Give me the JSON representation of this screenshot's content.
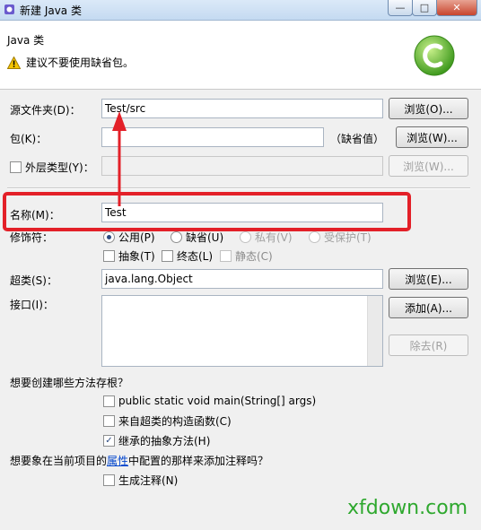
{
  "window": {
    "title": "新建 Java 类",
    "buttons": {
      "minimize": "—",
      "maximize": "□",
      "close": "✕"
    }
  },
  "header": {
    "heading": "Java 类",
    "warning": "建议不要使用缺省包。"
  },
  "form": {
    "source_folder": {
      "label": "源文件夹(D)：",
      "value": "Test/src",
      "button": "浏览(O)..."
    },
    "package": {
      "label": "包(K)：",
      "value": "",
      "hint": "（缺省值）",
      "button": "浏览(W)..."
    },
    "enclosing": {
      "label": "外层类型(Y)：",
      "checked": false,
      "value": "",
      "button": "浏览(W)..."
    },
    "name": {
      "label": "名称(M)：",
      "value": "Test"
    },
    "modifiers": {
      "label": "修饰符：",
      "access": [
        {
          "label": "公用(P)",
          "selected": true,
          "enabled": true
        },
        {
          "label": "缺省(U)",
          "selected": false,
          "enabled": true
        },
        {
          "label": "私有(V)",
          "selected": false,
          "enabled": false
        },
        {
          "label": "受保护(T)",
          "selected": false,
          "enabled": false
        }
      ],
      "flags": [
        {
          "label": "抽象(T)",
          "checked": false
        },
        {
          "label": "终态(L)",
          "checked": false
        },
        {
          "label": "静态(C)",
          "checked": false,
          "enabled": false
        }
      ]
    },
    "superclass": {
      "label": "超类(S)：",
      "value": "java.lang.Object",
      "button": "浏览(E)..."
    },
    "interfaces": {
      "label": "接口(I)：",
      "add_button": "添加(A)...",
      "remove_button": "除去(R)"
    },
    "stubs": {
      "question": "想要创建哪些方法存根？",
      "options": [
        {
          "label": "public static void main(String[] args)",
          "checked": false
        },
        {
          "label": "来自超类的构造函数(C)",
          "checked": false
        },
        {
          "label": "继承的抽象方法(H)",
          "checked": true
        }
      ]
    },
    "comments": {
      "question_pre": "想要象在当前项目的",
      "question_link": "属性",
      "question_post": "中配置的那样来添加注释吗？",
      "option": {
        "label": "生成注释(N)",
        "checked": false
      }
    }
  },
  "watermark": "xfdown.com",
  "colors": {
    "highlight": "#e32028",
    "arrow": "#e32028",
    "watermark": "#2ea82e",
    "logo": "#5cb82e"
  }
}
